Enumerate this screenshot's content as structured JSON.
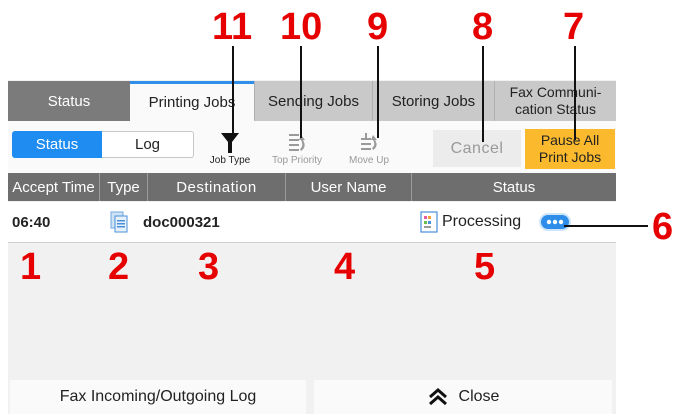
{
  "tabs": [
    {
      "label": "Status"
    },
    {
      "label": "Printing Jobs"
    },
    {
      "label": "Sending Jobs"
    },
    {
      "label": "Storing Jobs"
    },
    {
      "label": "Fax Communi-\ncation Status"
    }
  ],
  "toolbar": {
    "status_label": "Status",
    "log_label": "Log",
    "job_type_label": "Job Type",
    "top_priority_label": "Top Priority",
    "move_up_label": "Move Up",
    "cancel_label": "Cancel",
    "pause_label": "Pause All\nPrint Jobs"
  },
  "table": {
    "columns": [
      "Accept Time",
      "Type",
      "Destination",
      "User Name",
      "Status"
    ],
    "rows": [
      {
        "accept_time": "06:40",
        "destination": "doc000321",
        "user_name": "",
        "status": "Processing"
      }
    ]
  },
  "footer": {
    "fax_log_label": "Fax Incoming/Outgoing Log",
    "close_label": "Close"
  },
  "callouts": [
    "1",
    "2",
    "3",
    "4",
    "5",
    "6",
    "7",
    "8",
    "9",
    "10",
    "11"
  ],
  "colors": {
    "accent_blue": "#1e8cf0",
    "pause_button": "#fbba2d",
    "callout_red": "#e60000",
    "header_gray": "#6e6e6e"
  }
}
